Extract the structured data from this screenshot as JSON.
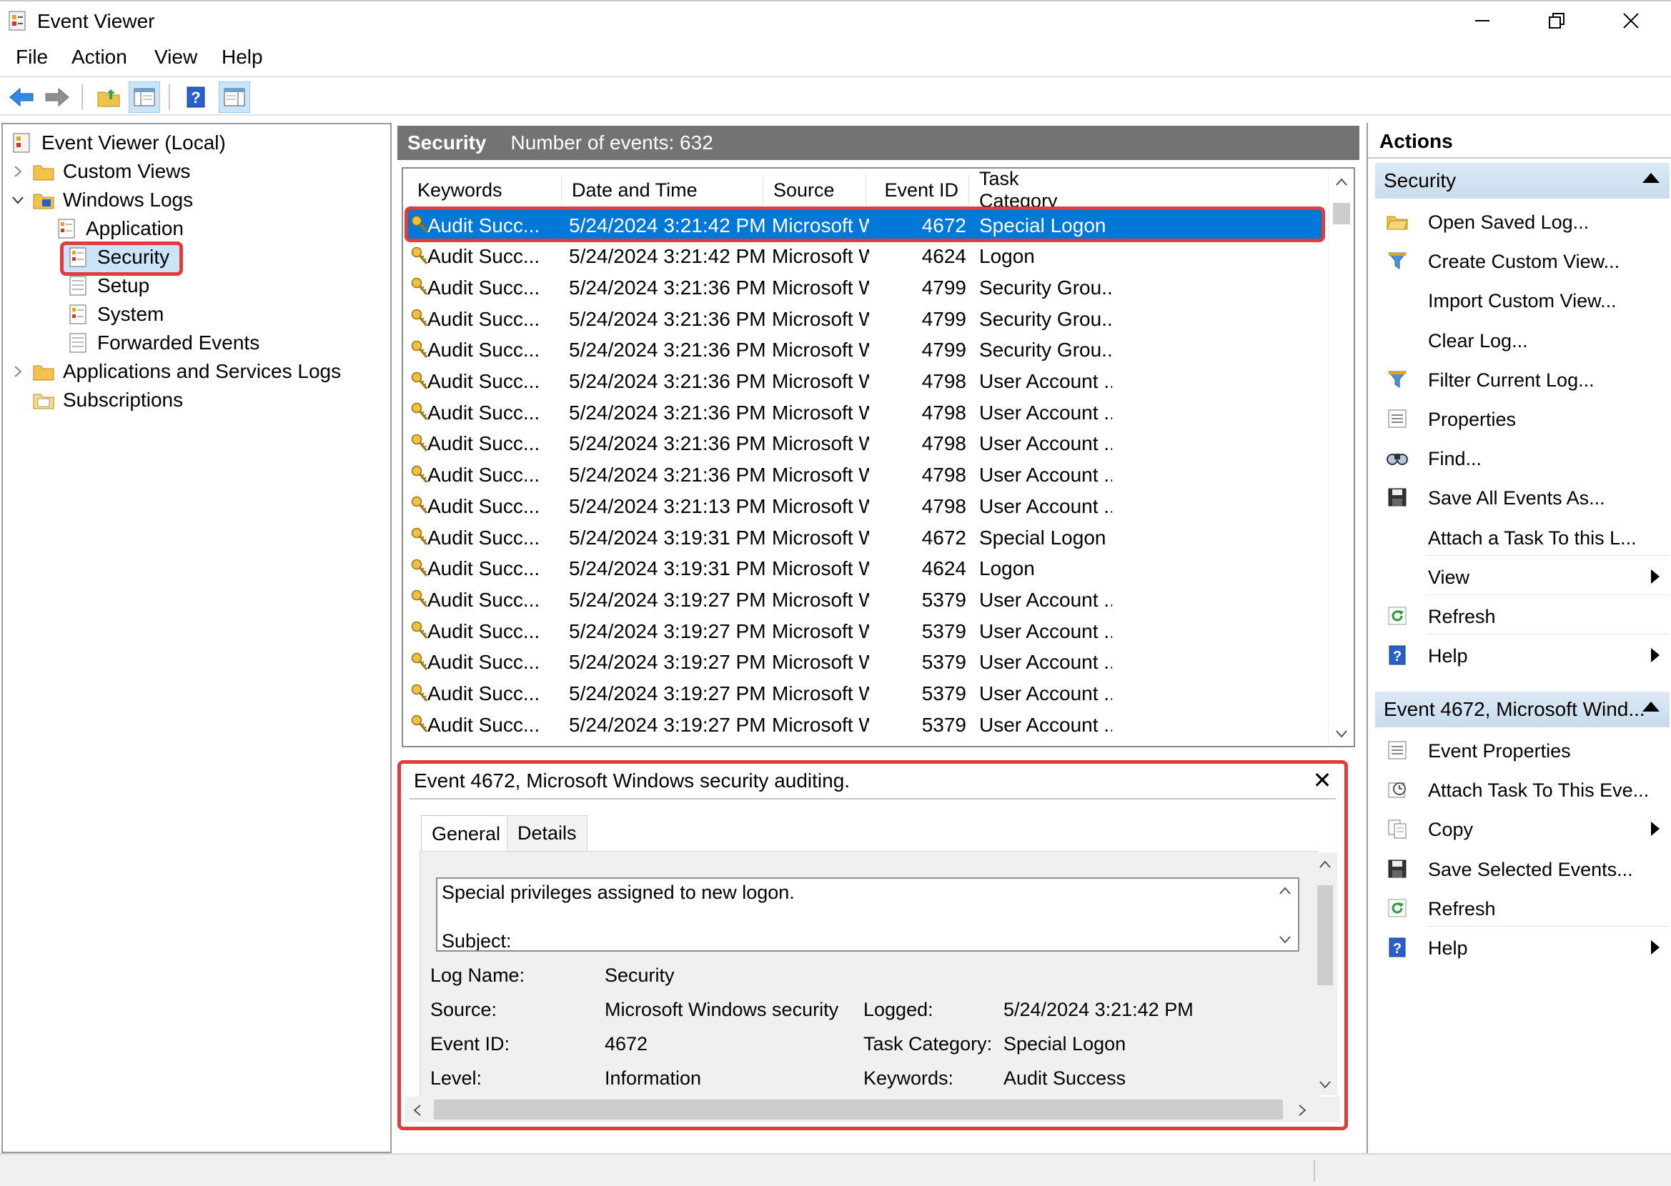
{
  "window": {
    "title": "Event Viewer",
    "minimize": "minimize",
    "restore": "restore",
    "close": "close"
  },
  "menu": [
    "File",
    "Action",
    "View",
    "Help"
  ],
  "tree": {
    "root": "Event Viewer (Local)",
    "custom_views": "Custom Views",
    "windows_logs": "Windows Logs",
    "logs": [
      "Application",
      "Security",
      "Setup",
      "System",
      "Forwarded Events"
    ],
    "apps_services": "Applications and Services Logs",
    "subscriptions": "Subscriptions"
  },
  "middle": {
    "title": "Security",
    "count_label": "Number of events: 632"
  },
  "columns": [
    "Keywords",
    "Date and Time",
    "Source",
    "Event ID",
    "Task Category"
  ],
  "events": [
    {
      "keywords": "Audit Succ...",
      "datetime": "5/24/2024 3:21:42 PM",
      "source": "Microsoft Wi...",
      "id": "4672",
      "category": "Special Logon"
    },
    {
      "keywords": "Audit Succ...",
      "datetime": "5/24/2024 3:21:42 PM",
      "source": "Microsoft Wi...",
      "id": "4624",
      "category": "Logon"
    },
    {
      "keywords": "Audit Succ...",
      "datetime": "5/24/2024 3:21:36 PM",
      "source": "Microsoft Wi...",
      "id": "4799",
      "category": "Security Grou..."
    },
    {
      "keywords": "Audit Succ...",
      "datetime": "5/24/2024 3:21:36 PM",
      "source": "Microsoft Wi...",
      "id": "4799",
      "category": "Security Grou..."
    },
    {
      "keywords": "Audit Succ...",
      "datetime": "5/24/2024 3:21:36 PM",
      "source": "Microsoft Wi...",
      "id": "4799",
      "category": "Security Grou..."
    },
    {
      "keywords": "Audit Succ...",
      "datetime": "5/24/2024 3:21:36 PM",
      "source": "Microsoft Wi...",
      "id": "4798",
      "category": "User Account ..."
    },
    {
      "keywords": "Audit Succ...",
      "datetime": "5/24/2024 3:21:36 PM",
      "source": "Microsoft Wi...",
      "id": "4798",
      "category": "User Account ..."
    },
    {
      "keywords": "Audit Succ...",
      "datetime": "5/24/2024 3:21:36 PM",
      "source": "Microsoft Wi...",
      "id": "4798",
      "category": "User Account ..."
    },
    {
      "keywords": "Audit Succ...",
      "datetime": "5/24/2024 3:21:36 PM",
      "source": "Microsoft Wi...",
      "id": "4798",
      "category": "User Account ..."
    },
    {
      "keywords": "Audit Succ...",
      "datetime": "5/24/2024 3:21:13 PM",
      "source": "Microsoft Wi...",
      "id": "4798",
      "category": "User Account ..."
    },
    {
      "keywords": "Audit Succ...",
      "datetime": "5/24/2024 3:19:31 PM",
      "source": "Microsoft Wi...",
      "id": "4672",
      "category": "Special Logon"
    },
    {
      "keywords": "Audit Succ...",
      "datetime": "5/24/2024 3:19:31 PM",
      "source": "Microsoft Wi...",
      "id": "4624",
      "category": "Logon"
    },
    {
      "keywords": "Audit Succ...",
      "datetime": "5/24/2024 3:19:27 PM",
      "source": "Microsoft Wi...",
      "id": "5379",
      "category": "User Account ..."
    },
    {
      "keywords": "Audit Succ...",
      "datetime": "5/24/2024 3:19:27 PM",
      "source": "Microsoft Wi...",
      "id": "5379",
      "category": "User Account ..."
    },
    {
      "keywords": "Audit Succ...",
      "datetime": "5/24/2024 3:19:27 PM",
      "source": "Microsoft Wi...",
      "id": "5379",
      "category": "User Account ..."
    },
    {
      "keywords": "Audit Succ...",
      "datetime": "5/24/2024 3:19:27 PM",
      "source": "Microsoft Wi...",
      "id": "5379",
      "category": "User Account ..."
    },
    {
      "keywords": "Audit Succ...",
      "datetime": "5/24/2024 3:19:27 PM",
      "source": "Microsoft Wi...",
      "id": "5379",
      "category": "User Account ..."
    }
  ],
  "details": {
    "title": "Event 4672, Microsoft Windows security auditing.",
    "tabs": [
      "General",
      "Details"
    ],
    "description": [
      "Special privileges assigned to new logon.",
      "Subject:"
    ],
    "fields": {
      "log_name_label": "Log Name:",
      "log_name": "Security",
      "source_label": "Source:",
      "source": "Microsoft Windows security",
      "logged_label": "Logged:",
      "logged": "5/24/2024 3:21:42 PM",
      "event_id_label": "Event ID:",
      "event_id": "4672",
      "task_label": "Task Category:",
      "task": "Special Logon",
      "level_label": "Level:",
      "level": "Information",
      "keywords_label": "Keywords:",
      "keywords": "Audit Success"
    }
  },
  "actions": {
    "header": "Actions",
    "section1": "Security",
    "items1": [
      "Open Saved Log...",
      "Create Custom View...",
      "Import Custom View...",
      "Clear Log...",
      "Filter Current Log...",
      "Properties",
      "Find...",
      "Save All Events As...",
      "Attach a Task To this L...",
      "View",
      "Refresh",
      "Help"
    ],
    "section2": "Event 4672, Microsoft Wind...",
    "items2": [
      "Event Properties",
      "Attach Task To This Eve...",
      "Copy",
      "Save Selected Events...",
      "Refresh",
      "Help"
    ]
  },
  "colors": {
    "selection": "#0078d7",
    "highlight": "#e03c3c",
    "header_bg": "#737373"
  }
}
